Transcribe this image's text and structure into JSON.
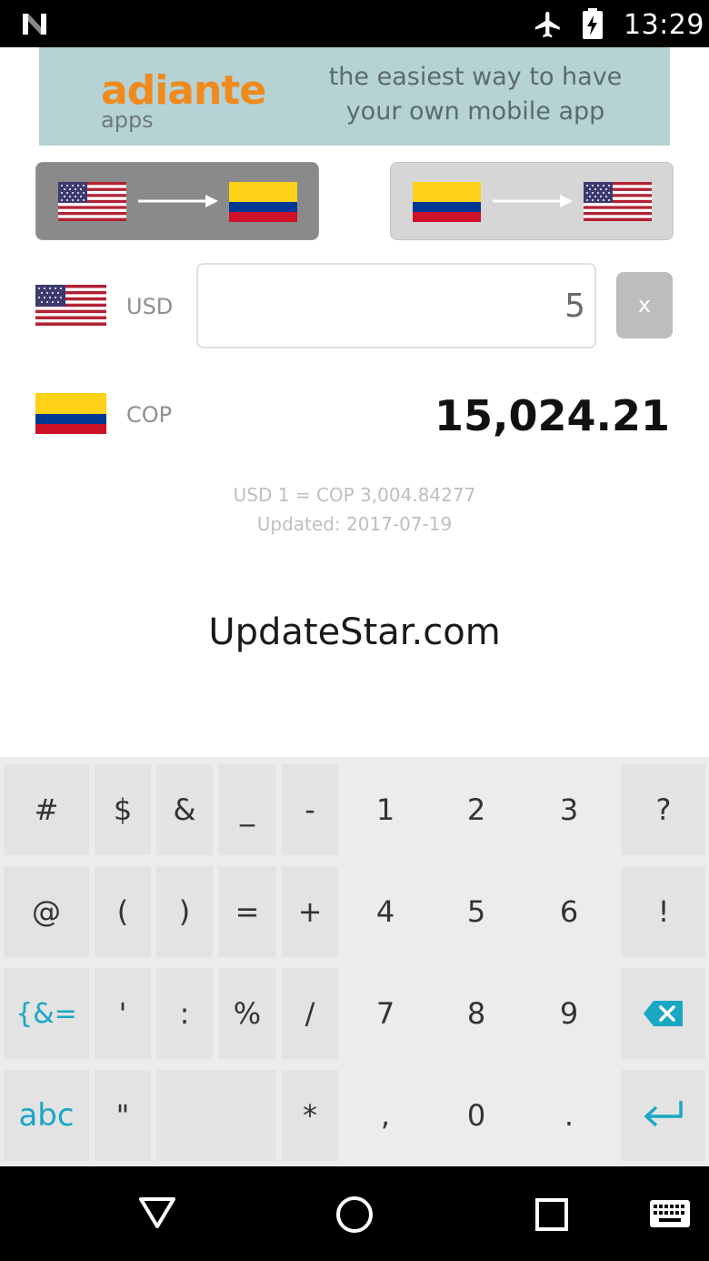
{
  "status_bar": {
    "time": "13:29",
    "icons": [
      "n-logo-icon",
      "airplane-mode-icon",
      "battery-charging-icon"
    ]
  },
  "ad_banner": {
    "brand": "adiante",
    "brand_sub": "apps",
    "tagline_line1": "the easiest way  to have",
    "tagline_line2": "your own mobile app"
  },
  "direction_buttons": [
    {
      "from": "us-flag-icon",
      "to": "colombia-flag-icon",
      "active": true
    },
    {
      "from": "colombia-flag-icon",
      "to": "us-flag-icon",
      "active": false
    }
  ],
  "source": {
    "currency_code": "USD",
    "amount": "5",
    "clear_label": "x"
  },
  "target": {
    "currency_code": "COP",
    "amount": "15,024.21"
  },
  "rate": {
    "line": "USD 1 = COP 3,004.84277",
    "updated": "Updated: 2017-07-19"
  },
  "watermark": "UpdateStar.com",
  "keyboard": {
    "row1": [
      "#",
      "$",
      "&",
      "_",
      "-",
      "1",
      "2",
      "3",
      "?"
    ],
    "row2": [
      "@",
      "(",
      ")",
      "=",
      "+",
      "4",
      "5",
      "6",
      "!"
    ],
    "row3": [
      "{&=",
      "'",
      ":",
      "%",
      "/",
      "7",
      "8",
      "9"
    ],
    "row4": [
      "abc",
      "\"",
      "*",
      ",",
      "0",
      "."
    ],
    "backspace_icon": "backspace-icon",
    "enter_icon": "enter-icon"
  },
  "colors": {
    "accent_teal": "#1aa7c4",
    "ad_orange": "#f08a1c",
    "ad_bg": "#b5d2d4"
  },
  "nav_bar": {
    "icons": [
      "back-icon",
      "home-icon",
      "recents-icon",
      "keyboard-icon"
    ]
  }
}
